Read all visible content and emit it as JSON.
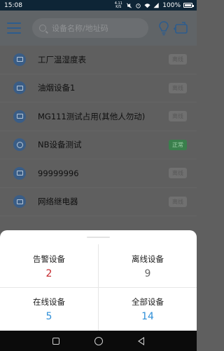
{
  "status_bar": {
    "time": "15:08",
    "network_speed": "4.11 K/S",
    "battery": "100%"
  },
  "header": {
    "search_placeholder": "设备名称/地址码",
    "icons": [
      "menu-icon",
      "search-icon",
      "bulb-icon",
      "switch-device-icon"
    ]
  },
  "devices": [
    {
      "name": "工厂温湿度表",
      "status": "离线"
    },
    {
      "name": "油烟设备1",
      "status": "离线"
    },
    {
      "name": "MG111测试占用(其他人勿动)",
      "status": "离线"
    },
    {
      "name": "NB设备测试",
      "status": "正常"
    },
    {
      "name": "99999996",
      "status": "离线"
    },
    {
      "name": "网络继电器",
      "status": "离线"
    }
  ],
  "summary": {
    "alarm": {
      "label": "告警设备",
      "count": "2",
      "color": "#c4252a"
    },
    "offline": {
      "label": "离线设备",
      "count": "9",
      "color": "#666666"
    },
    "online": {
      "label": "在线设备",
      "count": "5",
      "color": "#2f8fd8"
    },
    "all": {
      "label": "全部设备",
      "count": "14",
      "color": "#2f8fd8"
    }
  },
  "colors": {
    "status_bar": "#0e2536",
    "accent": "#2d5c8d",
    "normal_badge": "#3a7f4c"
  }
}
